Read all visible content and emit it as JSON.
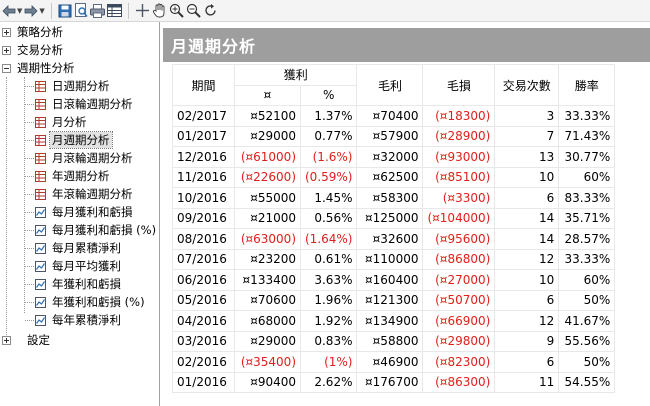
{
  "toolbar": {
    "buttons": [
      "back-icon",
      "forward-icon",
      "save-icon",
      "print-preview-icon",
      "print-icon",
      "table-view-icon",
      "crosshair-icon",
      "pan-hand-icon",
      "zoom-in-icon",
      "zoom-out-icon",
      "refresh-icon"
    ]
  },
  "tree": {
    "top_nodes": [
      {
        "label": "策略分析",
        "expanded": false
      },
      {
        "label": "交易分析",
        "expanded": false
      },
      {
        "label": "週期性分析",
        "expanded": true
      }
    ],
    "children": [
      {
        "label": "日週期分析",
        "icon": "table-report-icon"
      },
      {
        "label": "日滾輪週期分析",
        "icon": "table-report-icon"
      },
      {
        "label": "月分析",
        "icon": "table-report-icon"
      },
      {
        "label": "月週期分析",
        "icon": "table-report-icon",
        "selected": true
      },
      {
        "label": "月滾輪週期分析",
        "icon": "table-report-icon"
      },
      {
        "label": "年週期分析",
        "icon": "table-report-icon"
      },
      {
        "label": "年滾輪週期分析",
        "icon": "table-report-icon"
      },
      {
        "label": "每月獲利和虧損",
        "icon": "chart-report-icon"
      },
      {
        "label": "每月獲利和虧損 (%)",
        "icon": "chart-report-icon"
      },
      {
        "label": "每月累積淨利",
        "icon": "chart-report-icon"
      },
      {
        "label": "每月平均獲利",
        "icon": "chart-report-icon"
      },
      {
        "label": "年獲利和虧損",
        "icon": "chart-report-icon"
      },
      {
        "label": "年獲利和虧損 (%)",
        "icon": "chart-report-icon"
      },
      {
        "label": "每年累積淨利",
        "icon": "chart-report-icon"
      }
    ],
    "settings": {
      "label": "設定",
      "expanded": false
    }
  },
  "main": {
    "title": "月週期分析",
    "headers": {
      "period": "期間",
      "profit": "獲利",
      "profit_amount": "¤",
      "profit_pct": "%",
      "gross_profit": "毛利",
      "gross_loss": "毛損",
      "trades": "交易次數",
      "win_rate": "勝率"
    },
    "rows": [
      {
        "period": "02/2017",
        "amount": "¤52100",
        "pct": "1.37%",
        "gross_profit": "¤70400",
        "gross_loss": "(¤18300)",
        "trades": "3",
        "win_rate": "33.33%",
        "negative": false
      },
      {
        "period": "01/2017",
        "amount": "¤29000",
        "pct": "0.77%",
        "gross_profit": "¤57900",
        "gross_loss": "(¤28900)",
        "trades": "7",
        "win_rate": "71.43%",
        "negative": false
      },
      {
        "period": "12/2016",
        "amount": "(¤61000)",
        "pct": "(1.6%)",
        "gross_profit": "¤32000",
        "gross_loss": "(¤93000)",
        "trades": "13",
        "win_rate": "30.77%",
        "negative": true
      },
      {
        "period": "11/2016",
        "amount": "(¤22600)",
        "pct": "(0.59%)",
        "gross_profit": "¤62500",
        "gross_loss": "(¤85100)",
        "trades": "10",
        "win_rate": "60%",
        "negative": true
      },
      {
        "period": "10/2016",
        "amount": "¤55000",
        "pct": "1.45%",
        "gross_profit": "¤58300",
        "gross_loss": "(¤3300)",
        "trades": "6",
        "win_rate": "83.33%",
        "negative": false
      },
      {
        "period": "09/2016",
        "amount": "¤21000",
        "pct": "0.56%",
        "gross_profit": "¤125000",
        "gross_loss": "(¤104000)",
        "trades": "14",
        "win_rate": "35.71%",
        "negative": false
      },
      {
        "period": "08/2016",
        "amount": "(¤63000)",
        "pct": "(1.64%)",
        "gross_profit": "¤32600",
        "gross_loss": "(¤95600)",
        "trades": "14",
        "win_rate": "28.57%",
        "negative": true
      },
      {
        "period": "07/2016",
        "amount": "¤23200",
        "pct": "0.61%",
        "gross_profit": "¤110000",
        "gross_loss": "(¤86800)",
        "trades": "12",
        "win_rate": "33.33%",
        "negative": false
      },
      {
        "period": "06/2016",
        "amount": "¤133400",
        "pct": "3.63%",
        "gross_profit": "¤160400",
        "gross_loss": "(¤27000)",
        "trades": "10",
        "win_rate": "60%",
        "negative": false
      },
      {
        "period": "05/2016",
        "amount": "¤70600",
        "pct": "1.96%",
        "gross_profit": "¤121300",
        "gross_loss": "(¤50700)",
        "trades": "6",
        "win_rate": "50%",
        "negative": false
      },
      {
        "period": "04/2016",
        "amount": "¤68000",
        "pct": "1.92%",
        "gross_profit": "¤134900",
        "gross_loss": "(¤66900)",
        "trades": "12",
        "win_rate": "41.67%",
        "negative": false
      },
      {
        "period": "03/2016",
        "amount": "¤29000",
        "pct": "0.83%",
        "gross_profit": "¤58800",
        "gross_loss": "(¤29800)",
        "trades": "9",
        "win_rate": "55.56%",
        "negative": false
      },
      {
        "period": "02/2016",
        "amount": "(¤35400)",
        "pct": "(1%)",
        "gross_profit": "¤46900",
        "gross_loss": "(¤82300)",
        "trades": "6",
        "win_rate": "50%",
        "negative": true
      },
      {
        "period": "01/2016",
        "amount": "¤90400",
        "pct": "2.62%",
        "gross_profit": "¤176700",
        "gross_loss": "(¤86300)",
        "trades": "11",
        "win_rate": "54.55%",
        "negative": false
      }
    ]
  },
  "colors": {
    "negative": "#e0201b",
    "title_bar": "#9e9e9e",
    "title_text": "#ffffff"
  }
}
